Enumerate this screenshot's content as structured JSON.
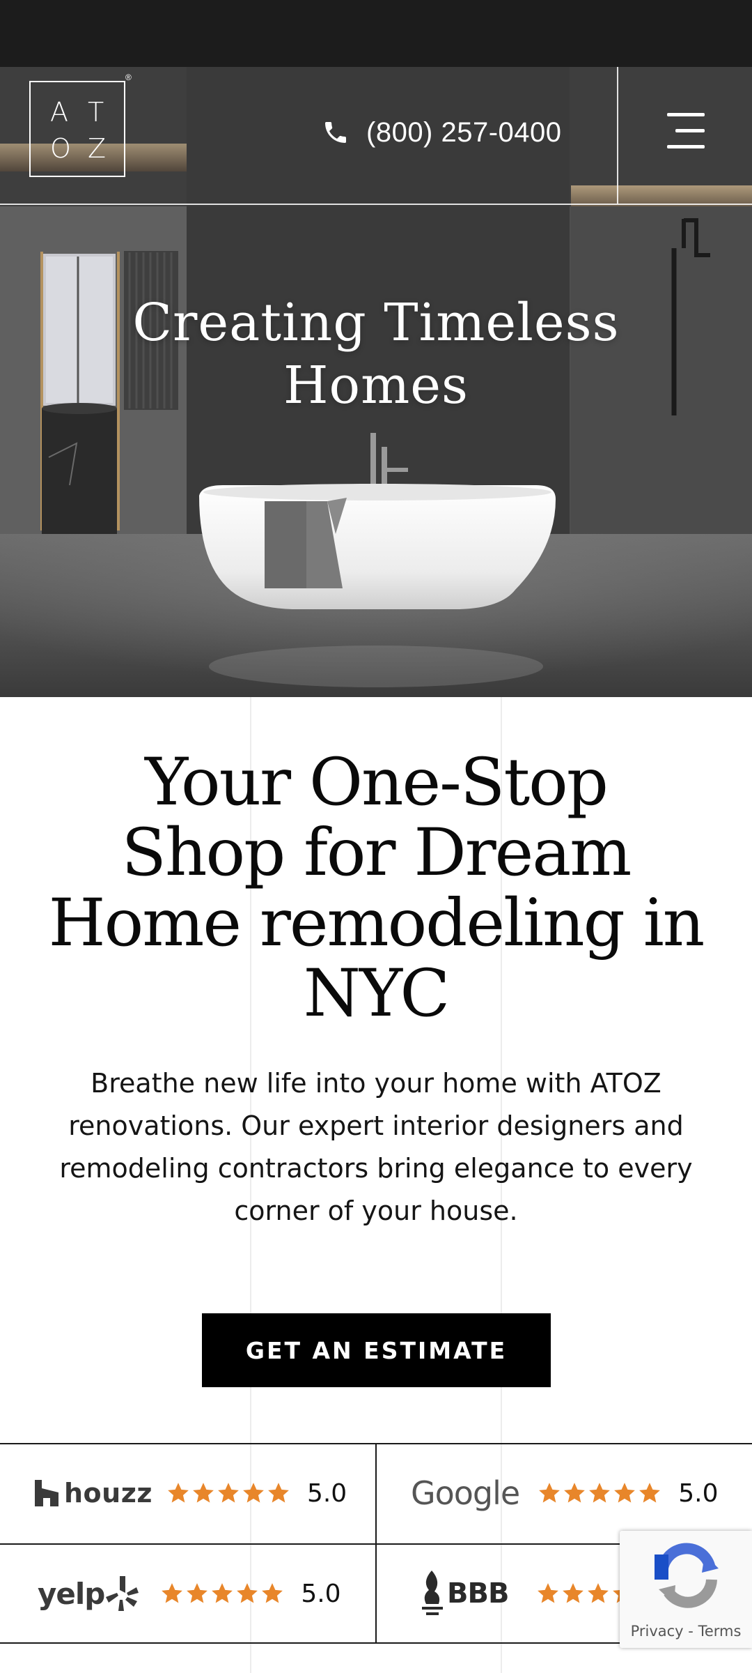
{
  "brand": {
    "logo_letters": [
      "A",
      "T",
      "O",
      "Z"
    ],
    "registered_mark": "®"
  },
  "header": {
    "phone": "(800) 257-0400"
  },
  "hero": {
    "title_line1": "Creating Timeless",
    "title_line2": "Homes"
  },
  "main": {
    "heading_line1": "Your One-Stop",
    "heading_line2": "Shop for Dream",
    "heading_line3": "Home remodeling in",
    "heading_line4": "NYC",
    "description": "Breathe new life into your home with ATOZ renovations. Our expert interior designers and remodeling contractors bring elegance to every corner of your house.",
    "cta_label": "GET AN ESTIMATE"
  },
  "ratings": [
    {
      "platform": "houzz",
      "label": "houzz",
      "stars": 5,
      "score": "5.0"
    },
    {
      "platform": "google",
      "label": "Google",
      "stars": 5,
      "score": "5.0"
    },
    {
      "platform": "yelp",
      "label": "yelp",
      "stars": 5,
      "score": "5.0"
    },
    {
      "platform": "bbb",
      "label": "BBB",
      "stars": 5,
      "score": ""
    }
  ],
  "recaptcha": {
    "privacy": "Privacy",
    "separator": " - ",
    "terms": "Terms"
  },
  "colors": {
    "star": "#E8862A",
    "cta_bg": "#000000",
    "status_bar": "#1C1C1C"
  },
  "icons": [
    "phone-icon",
    "menu-icon",
    "star-icon",
    "houzz-logo-icon",
    "yelp-burst-icon",
    "bbb-torch-icon",
    "recaptcha-icon"
  ]
}
